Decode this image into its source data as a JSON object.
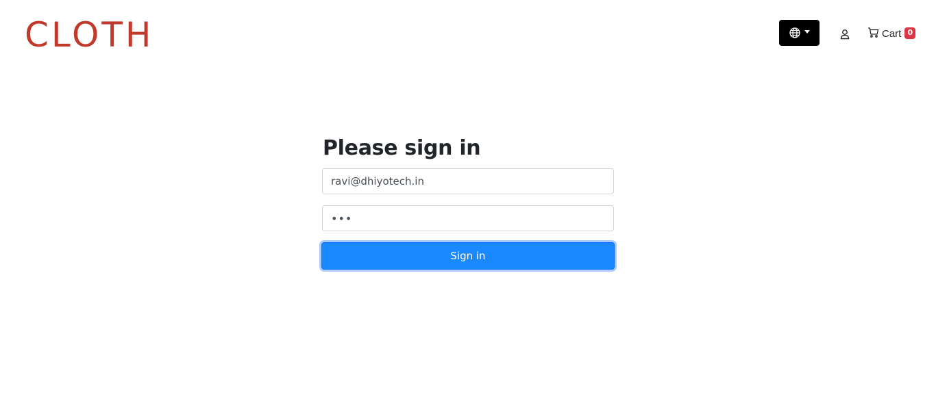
{
  "header": {
    "logo_text": "CLOTH",
    "language_button": {
      "icon": "globe-icon",
      "caret_icon": "caret-down-icon"
    },
    "account": {
      "icon": "user-icon"
    },
    "cart": {
      "icon": "cart-icon",
      "label": "Cart",
      "count": "0"
    }
  },
  "login_form": {
    "title": "Please sign in",
    "email_value": "ravi@dhiyotech.in",
    "password_value": "•••",
    "submit_label": "Sign in"
  },
  "colors": {
    "logo": "#c0392b",
    "language_button_bg": "#000000",
    "badge": "#dc3545",
    "primary_button": "#1a88ff"
  }
}
